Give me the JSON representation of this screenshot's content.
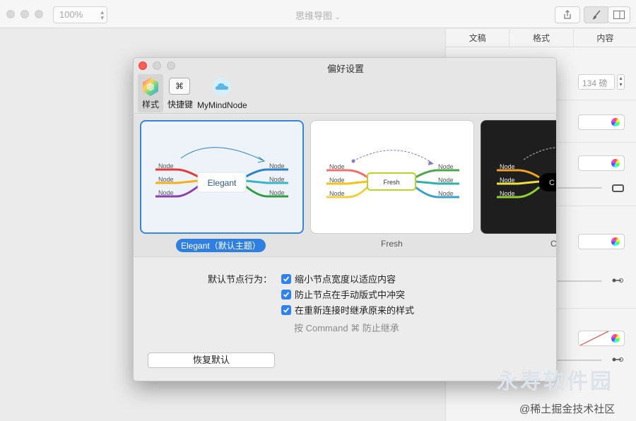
{
  "main_window": {
    "zoom_value": "100%",
    "document_title": "思维导图",
    "toolbar_icons": [
      "share-icon",
      "brush-icon",
      "sidebar-icon"
    ]
  },
  "inspector": {
    "tabs": [
      "文稿",
      "格式",
      "内容"
    ],
    "font_size": "134 磅"
  },
  "prefs": {
    "title": "偏好设置",
    "toolbar": [
      {
        "label": "样式",
        "icon": "style-color-icon",
        "selected": true
      },
      {
        "label": "快捷键",
        "icon": "command-key-icon",
        "key": "⌘"
      },
      {
        "label": "MyMindNode",
        "icon": "cloud-icon"
      }
    ],
    "themes": [
      {
        "caption": "Elegant（默认主题）",
        "center_label": "Elegant",
        "node_label": "Node",
        "selected": true
      },
      {
        "caption": "Fresh",
        "center_label": "Fresh",
        "node_label": "Node",
        "selected": false
      },
      {
        "caption": "C",
        "center_label": "C",
        "node_label": "Node",
        "selected": false
      }
    ],
    "behavior_label": "默认节点行为：",
    "options": [
      {
        "label": "缩小节点宽度以适应内容",
        "checked": true
      },
      {
        "label": "防止节点在手动版式中冲突",
        "checked": true
      },
      {
        "label": "在重新连接时继承原来的样式",
        "checked": true
      }
    ],
    "hint": "按 Command ⌘ 防止继承",
    "restore_button": "恢复默认"
  },
  "watermark": {
    "logo_text": "永寿软件园",
    "text": "@稀土掘金技术社区"
  },
  "colors": {
    "accent": "#2f7fe0",
    "checkbox": "#2f82ec"
  }
}
